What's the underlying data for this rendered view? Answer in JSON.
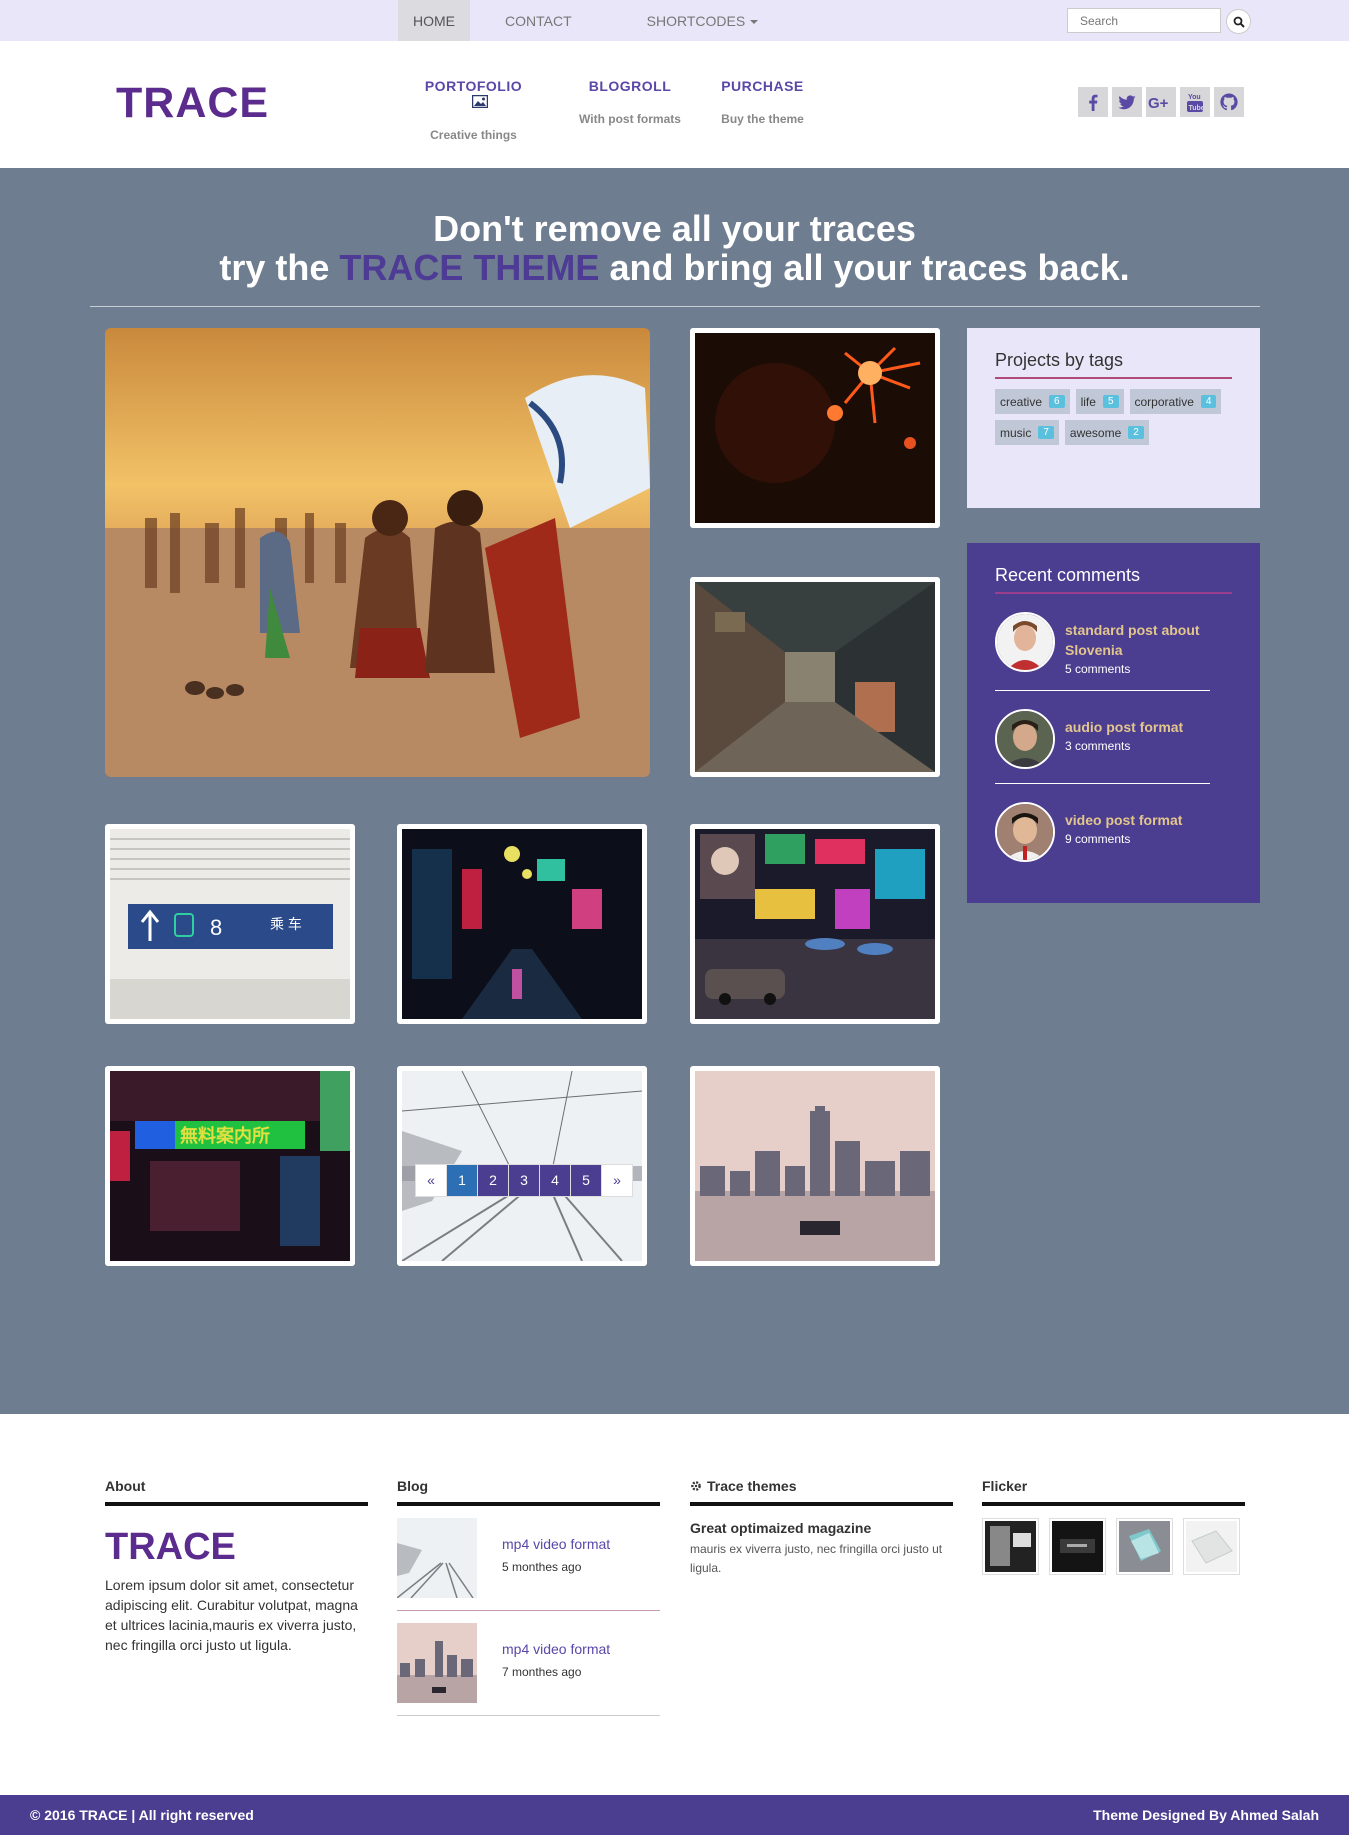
{
  "topnav": {
    "items": [
      {
        "label": "HOME"
      },
      {
        "label": "CONTACT"
      },
      {
        "label": "SHORTCODES"
      }
    ],
    "search_placeholder": "Search"
  },
  "header": {
    "logo": "TRACE",
    "nav": [
      {
        "label": "PORTOFOLIO",
        "sub": "Creative things"
      },
      {
        "label": "BLOGROLL",
        "sub": "With post formats"
      },
      {
        "label": "PURCHASE",
        "sub": "Buy the theme"
      }
    ],
    "social": [
      "facebook-icon",
      "twitter-icon",
      "google-plus-icon",
      "youtube-icon",
      "github-icon"
    ],
    "colors": {
      "brand": "#5b2b8e",
      "accent": "#4b3d8f",
      "hero_bg": "#6e7d8f"
    }
  },
  "hero": {
    "line1": "Don't remove all your traces",
    "line2_pre": "try the",
    "line2_highlight": "TRACE THEME",
    "line2_post": "and bring all your traces back."
  },
  "sidebar": {
    "tags_title": "Projects by tags",
    "tags": [
      {
        "name": "creative",
        "count": "6"
      },
      {
        "name": "life",
        "count": "5"
      },
      {
        "name": "corporative",
        "count": "4"
      },
      {
        "name": "music",
        "count": "7"
      },
      {
        "name": "awesome",
        "count": "2"
      }
    ],
    "comments_title": "Recent comments",
    "comments": [
      {
        "title": "standard post about Slovenia",
        "count": "5 comments"
      },
      {
        "title": "audio post format",
        "count": "3 comments"
      },
      {
        "title": "video post format",
        "count": "9 comments"
      }
    ]
  },
  "pagination": {
    "prev": "«",
    "pages": [
      "1",
      "2",
      "3",
      "4",
      "5"
    ],
    "next": "»"
  },
  "footer": {
    "about": {
      "heading": "About",
      "logo": "TRACE",
      "text": "Lorem ipsum dolor sit amet, consectetur adipiscing elit. Curabitur volutpat, magna et ultrices lacinia,mauris ex viverra justo, nec fringilla orci justo ut ligula."
    },
    "blog": {
      "heading": "Blog",
      "posts": [
        {
          "title": "mp4 video format",
          "date": "5 monthes ago"
        },
        {
          "title": "mp4 video format",
          "date": "7 monthes ago"
        }
      ]
    },
    "themes": {
      "heading": "Trace themes",
      "title": "Great optimaized magazine",
      "text": "mauris ex viverra justo, nec fringilla orci justo ut ligula."
    },
    "flicker": {
      "heading": "Flicker"
    }
  },
  "bottombar": {
    "copyright": "© 2016 TRACE | All right reserved",
    "credit": "Theme Designed By Ahmed Salah"
  }
}
